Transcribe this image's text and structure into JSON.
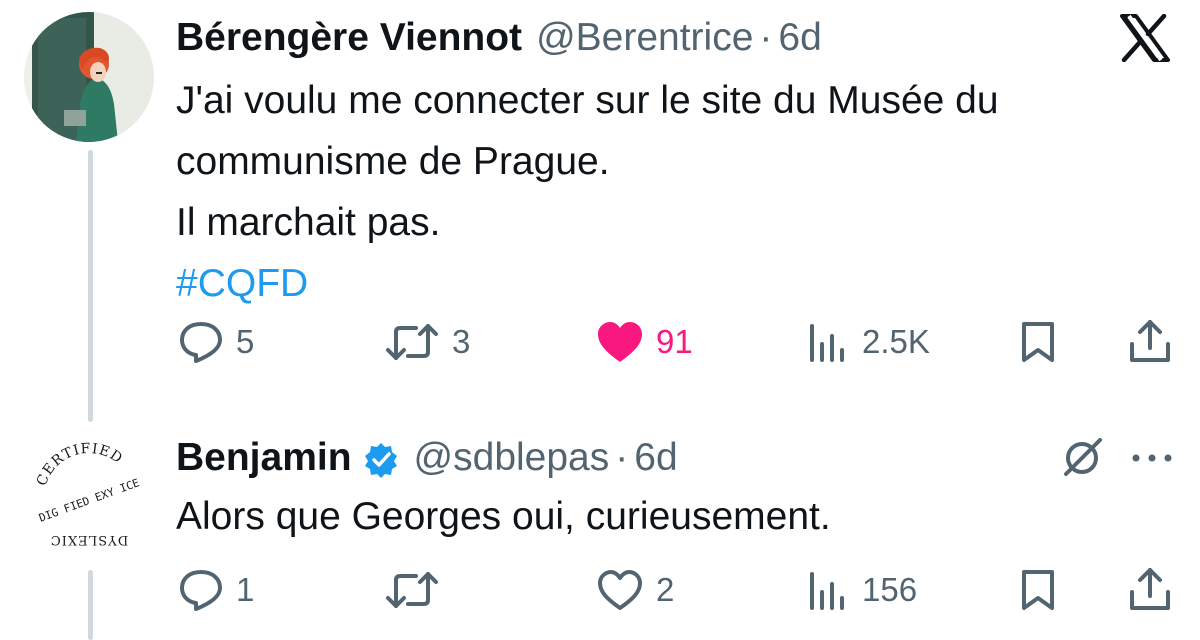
{
  "tweets": [
    {
      "author_name": "Bérengère Viennot",
      "handle": "@Berentrice",
      "separator": "·",
      "time": "6d",
      "body_lines": [
        "J'ai voulu me connecter sur le site du Musée du",
        "communisme de Prague.",
        "Il marchait pas."
      ],
      "hashtag": "#CQFD",
      "replies": "5",
      "retweets": "3",
      "likes": "91",
      "liked": true,
      "views": "2.5K",
      "icons": [
        "reply-icon",
        "retweet-icon",
        "heart-filled-icon",
        "views-icon",
        "bookmark-icon",
        "share-icon"
      ]
    },
    {
      "author_name": "Benjamin",
      "handle": "@sdblepas",
      "separator": "·",
      "time": "6d",
      "verified": true,
      "body_lines": [
        "Alors que Georges oui, curieusement."
      ],
      "replies": "1",
      "retweets": "",
      "likes": "2",
      "liked": false,
      "views": "156",
      "icons": [
        "reply-icon",
        "retweet-icon",
        "heart-outline-icon",
        "views-icon",
        "bookmark-icon",
        "share-icon"
      ]
    }
  ],
  "avatar2_badge": {
    "top_text": "CERTIFIED",
    "bottom_text": "DYSLEXIC",
    "center_letters": "DIG FIED EXY ICE"
  },
  "colors": {
    "text": "#0f1419",
    "muted": "#536471",
    "link": "#1d9bf0",
    "like": "#f91880",
    "thread_line": "#cfd9de"
  },
  "corner_icons": [
    "x-logo-icon",
    "grok-icon",
    "more-icon"
  ]
}
